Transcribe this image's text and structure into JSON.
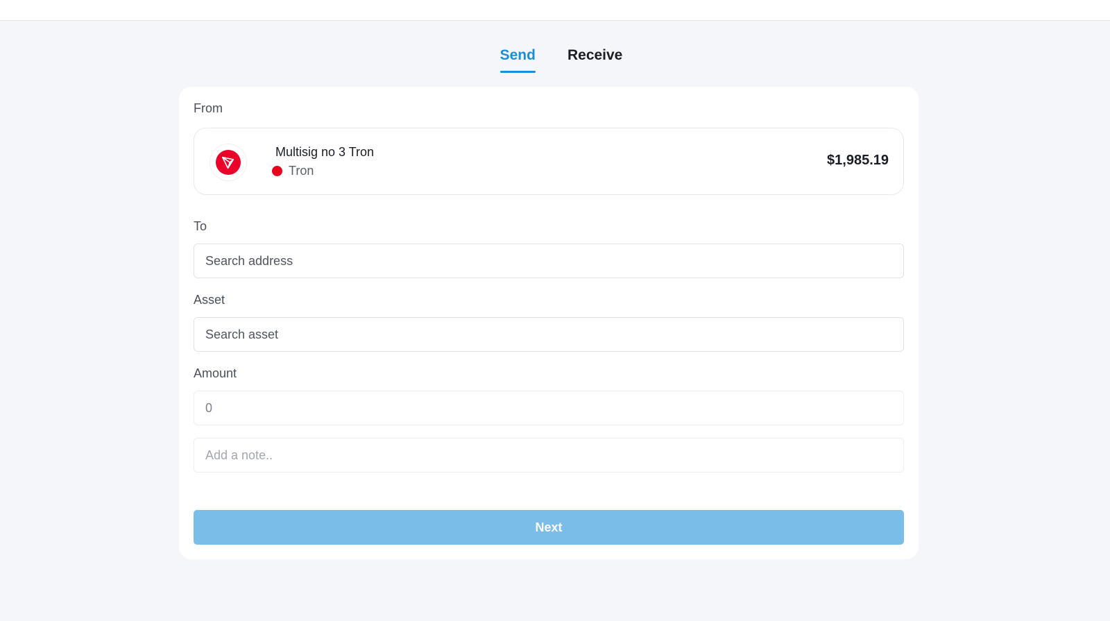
{
  "tabs": [
    {
      "label": "Send",
      "active": true
    },
    {
      "label": "Receive",
      "active": false
    }
  ],
  "form": {
    "from_label": "From",
    "from": {
      "wallet_name": "Multisig no 3 Tron",
      "network": "Tron",
      "balance": "$1,985.19",
      "icon": "tron-logo-icon",
      "network_color": "#e8001f"
    },
    "to_label": "To",
    "to_placeholder": "Search address",
    "asset_label": "Asset",
    "asset_placeholder": "Search asset",
    "amount_label": "Amount",
    "amount_value": "0",
    "note_placeholder": "Add a note..",
    "next_label": "Next"
  },
  "colors": {
    "accent": "#1b8fd6",
    "button_disabled": "#7bbde9",
    "tron_red": "#eb0029"
  }
}
